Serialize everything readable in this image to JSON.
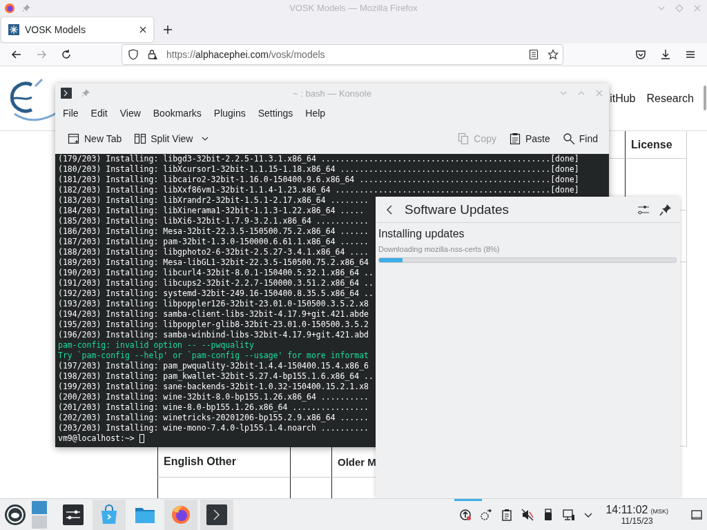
{
  "firefox": {
    "title": "VOSK Models — Mozilla Firefox",
    "tabs": [
      {
        "label": "VOSK Models",
        "selected": true
      }
    ],
    "url": {
      "prefix": "https://",
      "host": "alphacephei.com",
      "path": "/vosk/models"
    }
  },
  "page": {
    "nav": [
      "itHub",
      "Research"
    ],
    "table": {
      "header": "License",
      "section_row": [
        "English Other",
        "Older M"
      ]
    }
  },
  "konsole": {
    "title": "~ : bash — Konsole",
    "menu": [
      "File",
      "Edit",
      "View",
      "Bookmarks",
      "Plugins",
      "Settings",
      "Help"
    ],
    "toolbar": [
      {
        "label": "New Tab",
        "kind": "new-tab",
        "disabled": false
      },
      {
        "label": "Split View",
        "kind": "split",
        "disabled": false
      },
      {
        "label": "Copy",
        "kind": "copy",
        "disabled": true
      },
      {
        "label": "Paste",
        "kind": "paste",
        "disabled": false
      },
      {
        "label": "Find",
        "kind": "find",
        "disabled": false
      }
    ],
    "lines": [
      {
        "kind": "output",
        "text": "(179/203) Installing: libgd3-32bit-2.2.5-11.3.1.x86_64 ................................................[done]"
      },
      {
        "kind": "output",
        "text": "(180/203) Installing: libXcursor1-32bit-1.1.15-1.18.x86_64 ............................................[done]"
      },
      {
        "kind": "output",
        "text": "(181/203) Installing: libcairo2-32bit-1.16.0-150400.9.6.x86_64 ........................................[done]"
      },
      {
        "kind": "output",
        "text": "(182/203) Installing: libXxf86vm1-32bit-1.1.4-1.23.x86_64 .............................................[done]"
      },
      {
        "kind": "output",
        "text": "(183/203) Installing: libXrandr2-32bit-1.5.1-2.17.x86_64 ........"
      },
      {
        "kind": "output",
        "text": "(184/203) Installing: libXinerama1-32bit-1.1.3-1.22.x86_64 ....."
      },
      {
        "kind": "output",
        "text": "(185/203) Installing: libXi6-32bit-1.7.9-3.2.1.x86_64 ..........."
      },
      {
        "kind": "output",
        "text": "(186/203) Installing: Mesa-32bit-22.3.5-150500.75.2.x86_64 ......"
      },
      {
        "kind": "output",
        "text": "(187/203) Installing: pam-32bit-1.3.0-150000.6.61.1.x86_64 ......"
      },
      {
        "kind": "output",
        "text": "(188/203) Installing: libgphoto2-6-32bit-2.5.27-3.4.1.x86_64 ...."
      },
      {
        "kind": "output",
        "text": "(189/203) Installing: Mesa-libGL1-32bit-22.3.5-150500.75.2.x86_64"
      },
      {
        "kind": "output",
        "text": "(190/203) Installing: libcurl4-32bit-8.0.1-150400.5.32.1.x86_64 .."
      },
      {
        "kind": "output",
        "text": "(191/203) Installing: libcups2-32bit-2.2.7-150000.3.51.2.x86_64 .."
      },
      {
        "kind": "output",
        "text": "(192/203) Installing: systemd-32bit-249.16-150400.8.35.5.x86_64 .."
      },
      {
        "kind": "output",
        "text": "(193/203) Installing: libpoppler126-32bit-23.01.0-150500.3.5.2.x8"
      },
      {
        "kind": "output",
        "text": "(194/203) Installing: samba-client-libs-32bit-4.17.9+git.421.abde"
      },
      {
        "kind": "output",
        "text": "(195/203) Installing: libpoppler-glib8-32bit-23.01.0-150500.3.5.2"
      },
      {
        "kind": "output",
        "text": "(196/203) Installing: samba-winbind-libs-32bit-4.17.9+git.421.abd"
      },
      {
        "kind": "notice",
        "text": "pam-config: invalid option -- --pwquality"
      },
      {
        "kind": "notice",
        "text": "Try `pam-config --help' or `pam-config --usage' for more informat"
      },
      {
        "kind": "output",
        "text": "(197/203) Installing: pam_pwquality-32bit-1.4.4-150400.15.4.x86_6"
      },
      {
        "kind": "output",
        "text": "(198/203) Installing: pam_kwallet-32bit-5.27.4-bp155.1.6.x86_64 .."
      },
      {
        "kind": "output",
        "text": "(199/203) Installing: sane-backends-32bit-1.0.32-150400.15.2.1.x8"
      },
      {
        "kind": "output",
        "text": "(200/203) Installing: wine-32bit-8.0-bp155.1.26.x86_64 .........."
      },
      {
        "kind": "output",
        "text": "(201/203) Installing: wine-8.0-bp155.1.26.x86_64 ................"
      },
      {
        "kind": "output",
        "text": "(202/203) Installing: winetricks-20201206-bp155.2.9.x86_64 ......"
      },
      {
        "kind": "output",
        "text": "(203/203) Installing: wine-mono-7.4.0-lp155.1.4.noarch .........."
      }
    ],
    "prompt": "vm9@localhost:~>"
  },
  "updates": {
    "title": "Software Updates",
    "heading": "Installing updates",
    "status": "Downloading mozilla-nss-certs (8%)",
    "level": 0.08
  },
  "taskbar": {
    "tasks": [
      {
        "kind": "settings",
        "running": false
      },
      {
        "kind": "store",
        "running": true
      },
      {
        "kind": "files",
        "running": false
      },
      {
        "kind": "browser",
        "running": true
      },
      {
        "kind": "terminal",
        "running": true
      }
    ],
    "time": "14:11:02",
    "timezone": "(MSK)",
    "date": "11/15/23"
  }
}
